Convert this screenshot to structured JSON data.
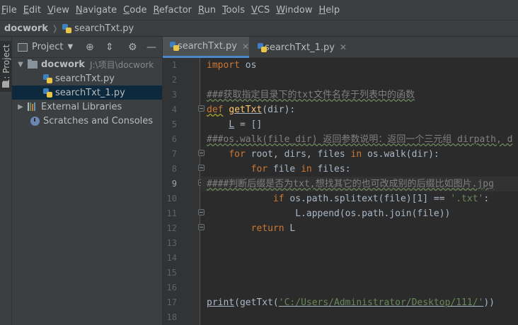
{
  "menu": [
    {
      "mnemonic": "F",
      "rest": "ile"
    },
    {
      "mnemonic": "E",
      "rest": "dit"
    },
    {
      "mnemonic": "V",
      "rest": "iew"
    },
    {
      "mnemonic": "N",
      "rest": "avigate"
    },
    {
      "mnemonic": "C",
      "rest": "ode"
    },
    {
      "mnemonic": "R",
      "rest": "efactor"
    },
    {
      "mnemonic": "R",
      "rest": "un"
    },
    {
      "mnemonic": "T",
      "rest": "ools"
    },
    {
      "mnemonic": "V",
      "rest": "CS"
    },
    {
      "mnemonic": "W",
      "rest": "indow"
    },
    {
      "mnemonic": "H",
      "rest": "elp"
    }
  ],
  "breadcrumb": {
    "root": "docwork",
    "file": "searchTxt.py"
  },
  "tool_stripe": {
    "label": "1: Project"
  },
  "project_panel": {
    "title": "Project",
    "tree": {
      "root_name": "docwork",
      "root_path": "J:\\项目\\docwork",
      "files": [
        "searchTxt.py",
        "searchTxt_1.py"
      ],
      "selected_file": "searchTxt_1.py",
      "external_libraries": "External Libraries",
      "scratches": "Scratches and Consoles"
    }
  },
  "editor": {
    "tabs": [
      {
        "label": "searchTxt.py",
        "active": true
      },
      {
        "label": "searchTxt_1.py",
        "active": false
      }
    ],
    "current_line": 9,
    "line_numbers": [
      "1",
      "2",
      "3",
      "4",
      "5",
      "6",
      "7",
      "8",
      "9",
      "10",
      "11",
      "12",
      "13",
      "14",
      "15",
      "16",
      "17",
      "18"
    ],
    "code": {
      "l1_kw": "import",
      "l1_rest": " os",
      "l3_comment": "###获取指定目录下的txt文件名存于列表中的函数",
      "l4_kw": "def",
      "l4_fn": "getTxt",
      "l4_rest": "(dir):",
      "l5_var": "L",
      "l5_rest": " = []",
      "l6_comment": "###os.walk(file_dir) 返回参数说明：返回一个三元组 dirpath, d",
      "l7_kw1": "for",
      "l7_mid": " root, dirs, files ",
      "l7_kw2": "in",
      "l7_rest": " os.walk(dir):",
      "l8_kw1": "for",
      "l8_mid": " file ",
      "l8_kw2": "in",
      "l8_rest": " files:",
      "l9_comment": "####判断后缀是否为txt,想找其它的也可改成别的后缀比如图片.jpg",
      "l10_kw": "if",
      "l10_mid": " os.path.splitext(file)[1] == ",
      "l10_str": "'.txt'",
      "l10_end": ":",
      "l11_text": "L.append(os.path.join(file))",
      "l12_kw": "return",
      "l12_rest": " L",
      "l17_fn": "print",
      "l17_mid": "(getTxt(",
      "l17_str": "'C:/Users/Administrator/Desktop/111/'",
      "l17_end": "))"
    }
  }
}
